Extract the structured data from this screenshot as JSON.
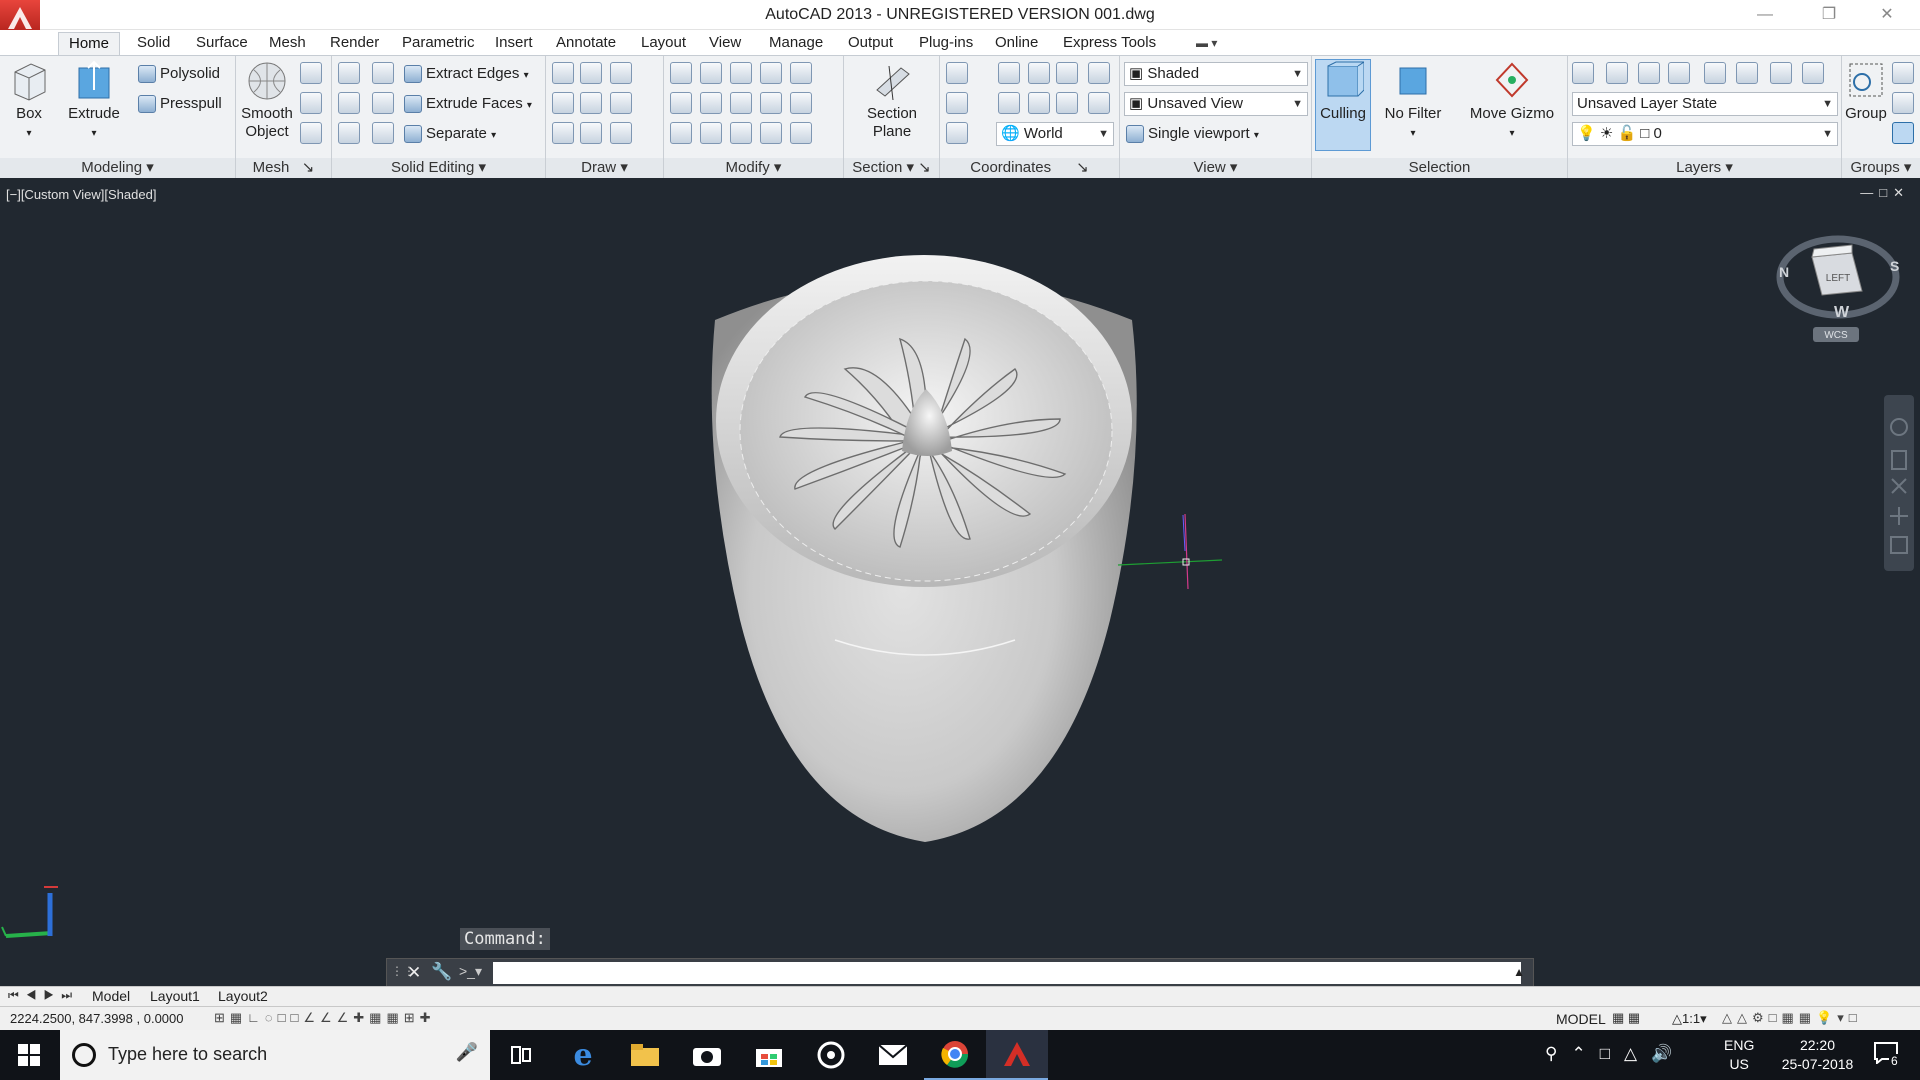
{
  "title": "AutoCAD 2013 - UNREGISTERED VERSION    001.dwg",
  "tabs": [
    "Home",
    "Solid",
    "Surface",
    "Mesh",
    "Render",
    "Parametric",
    "Insert",
    "Annotate",
    "Layout",
    "View",
    "Manage",
    "Output",
    "Plug-ins",
    "Online",
    "Express Tools"
  ],
  "ribbon": {
    "modeling": {
      "label": "Modeling",
      "box": "Box",
      "extrude": "Extrude",
      "polysolid": "Polysolid",
      "presspull": "Presspull"
    },
    "mesh": {
      "label": "Mesh",
      "smooth1": "Smooth",
      "smooth2": "Object"
    },
    "solid_editing": {
      "label": "Solid Editing",
      "extract_edges": "Extract Edges",
      "extrude_faces": "Extrude Faces",
      "separate": "Separate"
    },
    "draw": {
      "label": "Draw"
    },
    "modify": {
      "label": "Modify"
    },
    "section": {
      "label": "Section",
      "section1": "Section",
      "section2": "Plane"
    },
    "coordinates": {
      "label": "Coordinates",
      "world": "World"
    },
    "view": {
      "label": "View",
      "visual_style": "Shaded",
      "saved_view": "Unsaved View",
      "viewport": "Single viewport"
    },
    "selection": {
      "label": "Selection",
      "culling": "Culling",
      "no_filter": "No Filter",
      "move_gizmo": "Move Gizmo"
    },
    "layers": {
      "label": "Layers",
      "layer_state": "Unsaved Layer State",
      "current_layer": "0"
    },
    "groups": {
      "label": "Groups",
      "group": "Group"
    }
  },
  "viewport": {
    "label": "[−][Custom View][Shaded]",
    "viewcube_face": "LEFT",
    "compass_n": "N",
    "compass_s": "S",
    "compass_w": "W",
    "wcs": "WCS"
  },
  "command": {
    "history": "Command:",
    "input": ""
  },
  "layout_tabs": [
    "Model",
    "Layout1",
    "Layout2"
  ],
  "status": {
    "coords": "2224.2500, 847.3998  , 0.0000",
    "model": "MODEL",
    "scale": "1:1"
  },
  "taskbar": {
    "search_placeholder": "Type here to search",
    "lang1": "ENG",
    "lang2": "US",
    "time": "22:20",
    "date": "25-07-2018",
    "notifications": "6"
  }
}
